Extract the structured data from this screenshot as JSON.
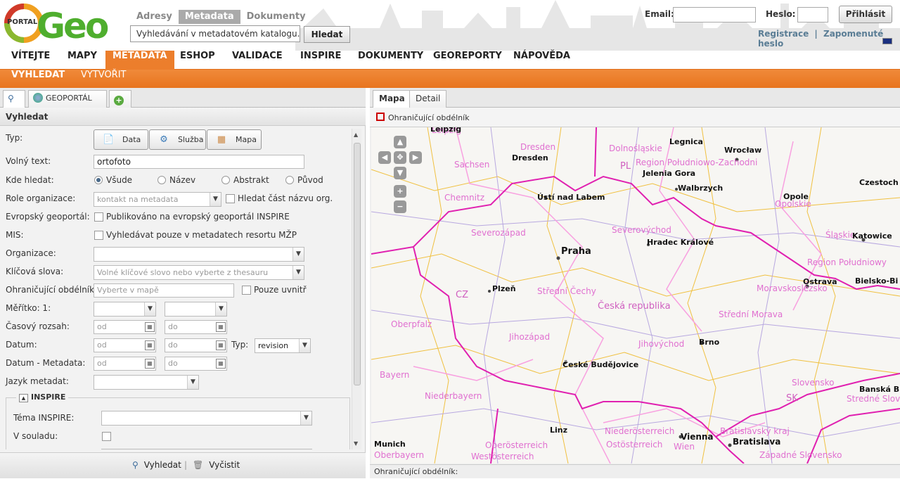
{
  "header": {
    "logo_portal": "PORTAL",
    "logo_geo": "Geo",
    "search_tabs": [
      "Adresy",
      "Metadata",
      "Dokumenty"
    ],
    "search_value": "Vyhledávání v metadatovém katalogu...",
    "search_button": "Hledat",
    "email_label": "Email:",
    "password_label": "Heslo:",
    "login_button": "Přihlásit",
    "register_link": "Registrace",
    "separator": "|",
    "forgot_link": "Zapomenuté heslo"
  },
  "mainnav": [
    "VÍTEJTE",
    "MAPY",
    "METADATA",
    "ESHOP",
    "VALIDACE",
    "INSPIRE",
    "DOKUMENTY",
    "GEOREPORTY",
    "NÁPOVĚDA"
  ],
  "subnav": {
    "search": "VYHLEDAT",
    "create": "VYTVOŘIT"
  },
  "left": {
    "tab_geoportal": "GEOPORTÁL ČR",
    "panel_title": "Vyhledat",
    "type_label": "Typ:",
    "type_buttons": [
      "Data",
      "Služba",
      "Mapa"
    ],
    "free_text_label": "Volný text:",
    "free_text_value": "ortofoto",
    "where_label": "Kde hledat:",
    "where_options": [
      "Všude",
      "Název",
      "Abstrakt",
      "Původ"
    ],
    "role_label": "Role organizace:",
    "role_value": "kontakt na metadata",
    "role_partial": "Hledat část názvu org.",
    "eu_label": "Evropský geoportál:",
    "eu_check": "Publikováno na evropský geoportál INSPIRE",
    "mis_label": "MIS:",
    "mis_check": "Vyhledávat pouze v metadatech resortu MŽP",
    "org_label": "Organizace:",
    "keywords_label": "Klíčová slova:",
    "keywords_placeholder": "Volné klíčové slovo nebo vyberte z thesauru",
    "bbox_label": "Ohraničující obdélník:",
    "bbox_placeholder": "Vyberte v mapě",
    "bbox_inside": "Pouze uvnitř",
    "scale_label": "Měřítko: 1:",
    "time_label": "Časový rozsah:",
    "from": "od",
    "to": "do",
    "date_label": "Datum:",
    "date_type_label": "Typ:",
    "date_type_value": "revision",
    "meta_date_label": "Datum - Metadata:",
    "lang_label": "Jazyk metadat:",
    "inspire_title": "INSPIRE",
    "inspire_theme_label": "Téma INSPIRE:",
    "conform_label": "V souladu:",
    "btn_search": "Vyhledat",
    "btn_clear": "Vyčistit"
  },
  "right": {
    "tab_map": "Mapa",
    "tab_detail": "Detail",
    "bbox_tool": "Ohraničující obdélník",
    "footer": "Ohraničující obdélník:"
  },
  "map_labels": {
    "cities": [
      "Leipzig",
      "Dresden",
      "Legnica",
      "Wrocław",
      "Jelenia Gora",
      "Walbrzych",
      "Opole",
      "Czestoch",
      "Ústí nad Labem",
      "Katowice",
      "Praha",
      "Hradec Králové",
      "Ostrava",
      "Bielsko-Bi",
      "Plzeň",
      "Brno",
      "České Budějovice",
      "Banská B",
      "Linz",
      "Vienna",
      "Bratislava",
      "Munich"
    ],
    "regions": [
      "Leipzig",
      "Dresden",
      "Dolnośląskie",
      "Sachsen",
      "Region Południowo-Zachodni",
      "Chemnitz",
      "Opolskie",
      "Śląskie",
      "Severozápad",
      "Severovýchod",
      "Region Południowy",
      "Střední Čechy",
      "Moravskoslezsko",
      "Česká republika",
      "Střední Morava",
      "Oberpfalz",
      "Jihozápad",
      "Jihovýchod",
      "Bayern",
      "Slovensko",
      "Stredné Slovensko",
      "Niederbayern",
      "Niederösterreich",
      "Bratislavský kraj",
      "Oberösterreich",
      "Ostösterreich",
      "Westösterreich",
      "Oberbayern",
      "Wien",
      "Západné Slovensko"
    ],
    "countries": [
      "PL",
      "CZ",
      "SK"
    ]
  }
}
